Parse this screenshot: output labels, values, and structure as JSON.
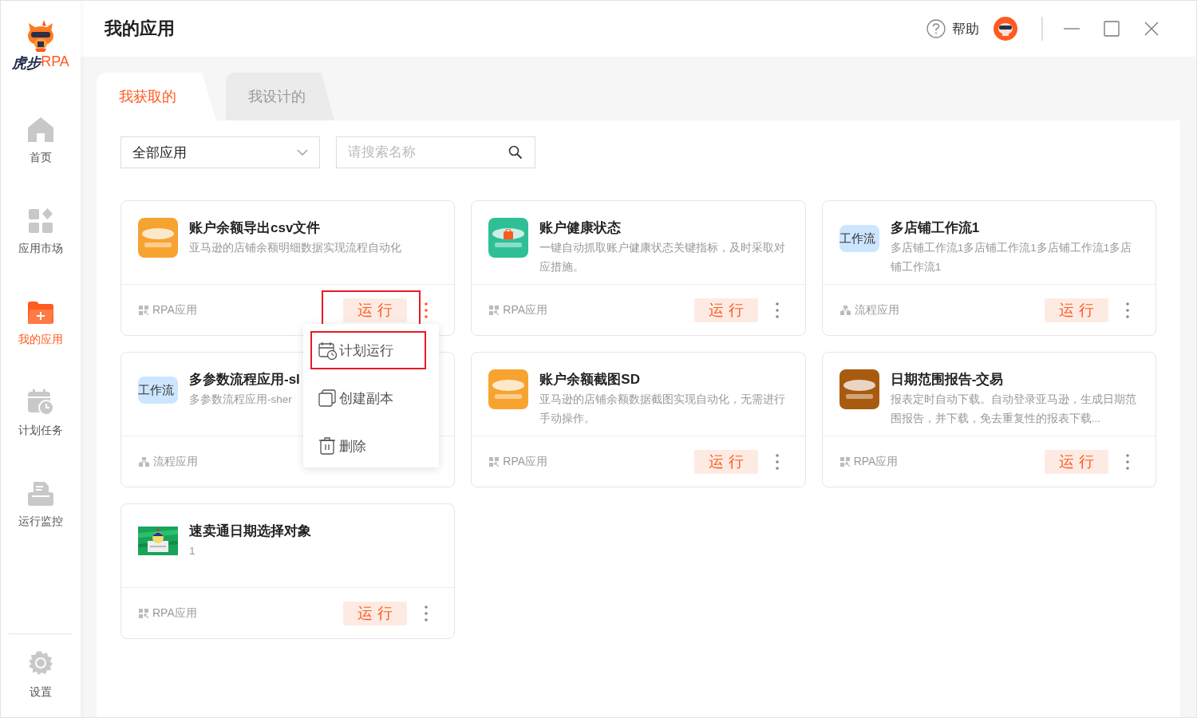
{
  "sidebar": {
    "logo": {
      "name": "虎步",
      "suffix": "RPA"
    },
    "items": [
      {
        "label": "首页",
        "kind": "home",
        "selected": false
      },
      {
        "label": "应用市场",
        "kind": "apps",
        "selected": false
      },
      {
        "label": "我的应用",
        "kind": "folder",
        "selected": true
      },
      {
        "label": "计划任务",
        "kind": "calendar",
        "selected": false
      },
      {
        "label": "运行监控",
        "kind": "monitor",
        "selected": false
      }
    ],
    "footer_item": {
      "label": "设置",
      "kind": "gear"
    }
  },
  "header": {
    "title": "我的应用",
    "help": "帮助"
  },
  "tabs": [
    {
      "label": "我获取的",
      "selected": true
    },
    {
      "label": "我设计的",
      "selected": false
    }
  ],
  "filter": {
    "category": "全部应用",
    "search": {
      "placeholder": "请搜索名称"
    }
  },
  "cards": [
    {
      "title": "账户余额导出csv文件",
      "description": "亚马逊的店铺余额明细数据实现流程自动化",
      "icon": {
        "kind": "amazon",
        "color": "#f7a330"
      },
      "type": {
        "kind": "rpa",
        "label": "RPA应用"
      },
      "run": {
        "label": "运行",
        "highlighted": true
      },
      "menu_open": true
    },
    {
      "title": "账户健康状态",
      "description": "一键自动抓取账户健康状态关键指标，及时采取对应措施。",
      "icon": {
        "kind": "shop",
        "color": "#2fbf97"
      },
      "type": {
        "kind": "rpa",
        "label": "RPA应用"
      },
      "run": {
        "label": "运行",
        "highlighted": false
      },
      "menu_open": false
    },
    {
      "title": "多店铺工作流1",
      "description": "多店铺工作流1多店铺工作流1多店铺工作流1多店铺工作流1",
      "icon": {
        "kind": "workflow",
        "color": "#cde6ff",
        "text": "工作流"
      },
      "type": {
        "kind": "flow",
        "label": "流程应用"
      },
      "run": {
        "label": "运行",
        "highlighted": false
      },
      "menu_open": false
    },
    {
      "title": "多参数流程应用-sl",
      "description": "多参数流程应用-sher",
      "icon": {
        "kind": "workflow",
        "color": "#cde6ff",
        "text": "工作流"
      },
      "type": {
        "kind": "flow",
        "label": "流程应用"
      },
      "menu_open": false
    },
    {
      "title": "账户余额截图SD",
      "description": "亚马逊的店铺余额数据截图实现自动化，无需进行手动操作。",
      "icon": {
        "kind": "amazon",
        "color": "#f7a330"
      },
      "type": {
        "kind": "rpa",
        "label": "RPA应用"
      },
      "run": {
        "label": "运行",
        "highlighted": false
      },
      "menu_open": false
    },
    {
      "title": "日期范围报告-交易",
      "description": "报表定时自动下载。自动登录亚马逊，生成日期范围报告，并下载，免去重复性的报表下载...",
      "icon": {
        "kind": "amazon",
        "color": "#a85a0e"
      },
      "type": {
        "kind": "rpa",
        "label": "RPA应用"
      },
      "run": {
        "label": "运行",
        "highlighted": false
      },
      "menu_open": false
    },
    {
      "title": "速卖通日期选择对象",
      "description": "1",
      "type": {
        "kind": "rpa",
        "label": "RPA应用"
      },
      "run": {
        "label": "运行",
        "highlighted": false
      },
      "menu_open": false
    }
  ],
  "context_menu": {
    "items": [
      {
        "label": "计划运行",
        "kind": "calendar",
        "highlighted": true
      },
      {
        "label": "创建副本",
        "kind": "copy",
        "highlighted": false
      },
      {
        "label": "删除",
        "kind": "trash",
        "highlighted": false
      }
    ]
  }
}
